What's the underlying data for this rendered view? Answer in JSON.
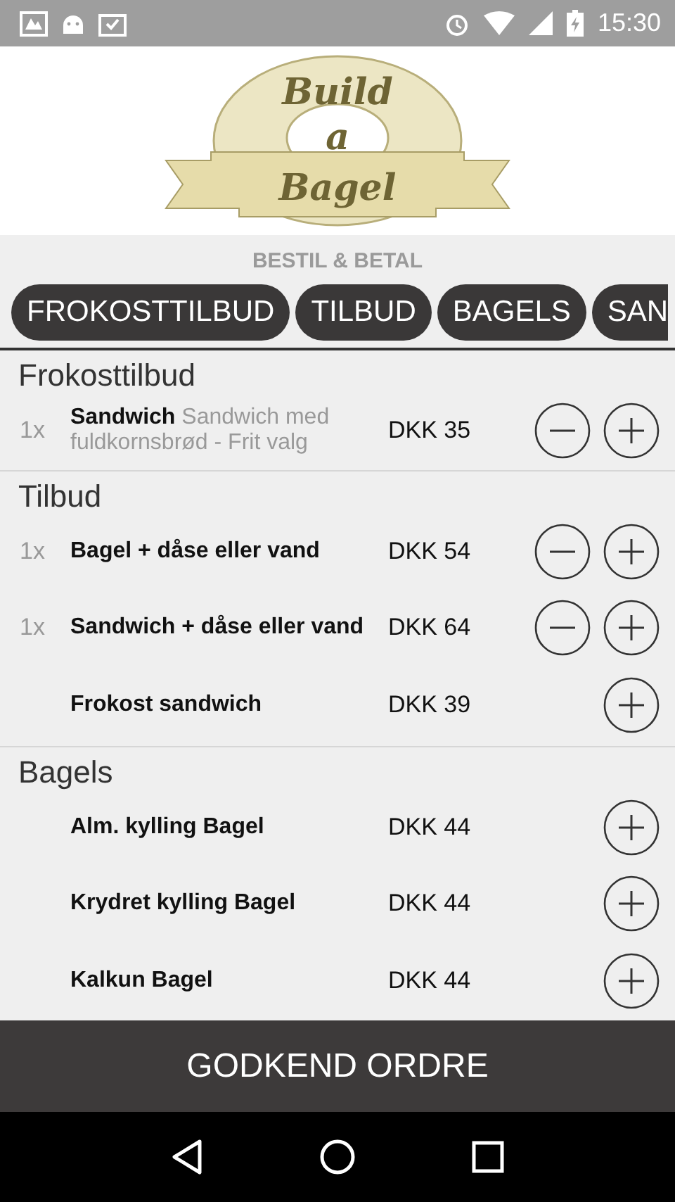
{
  "status_bar": {
    "time": "15:30"
  },
  "logo": {
    "line_1": "Build",
    "line_2": "a",
    "line_3": "Bagel"
  },
  "subtitle": "BESTIL & BETAL",
  "tabs": [
    {
      "label": "FROKOSTTILBUD",
      "selected": false
    },
    {
      "label": "TILBUD",
      "selected": false
    },
    {
      "label": "BAGELS",
      "selected": false
    },
    {
      "label": "SAN",
      "selected": false
    }
  ],
  "sections": [
    {
      "title": "Frokosttilbud",
      "items": [
        {
          "quantity": "1x",
          "name": "Sandwich",
          "description": "Sandwich med fuldkornsbrød - Frit valg",
          "price": "DKK 35"
        }
      ]
    },
    {
      "title": "Tilbud",
      "items": [
        {
          "quantity": "1x",
          "name": "Bagel + dåse eller vand",
          "price": "DKK 54"
        },
        {
          "quantity": "1x",
          "name": "Sandwich + dåse eller vand",
          "price": "DKK 64"
        },
        {
          "name": "Frokost sandwich",
          "price": "DKK 39"
        }
      ]
    },
    {
      "title": "Bagels",
      "items": [
        {
          "name": "Alm. kylling Bagel",
          "price": "DKK 44"
        },
        {
          "name": "Krydret kylling Bagel",
          "price": "DKK 44"
        },
        {
          "name": "Kalkun Bagel",
          "price": "DKK 44"
        }
      ]
    }
  ],
  "confirm_button": "GODKEND ORDRE"
}
